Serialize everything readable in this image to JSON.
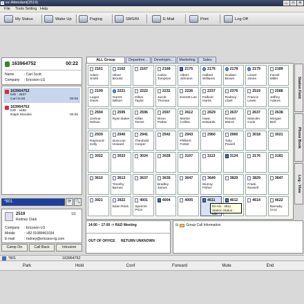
{
  "window": {
    "title": "ez-Attendant(2519)",
    "min": "_",
    "max": "□",
    "close": "✕"
  },
  "menu": [
    "File",
    "Tools Setting",
    "Help"
  ],
  "toolbar": [
    {
      "label": "My Status",
      "icon": "status-icon"
    },
    {
      "label": "Wake Up",
      "icon": "alarm-icon"
    },
    {
      "label": "Paging",
      "icon": "paging-icon"
    },
    {
      "label": "SMS/M",
      "icon": "sms-icon"
    },
    {
      "label": "E-Mail",
      "icon": "email-icon"
    },
    {
      "label": "Print",
      "icon": "print-icon"
    },
    {
      "label": "Log Off",
      "icon": "logoff-icon"
    }
  ],
  "current_call": {
    "number": "163964752",
    "timer": "00:22",
    "name_label": "Name",
    "name_value": ": Carl Scott",
    "company_label": "Company",
    "company_value": ": Ericsson-LG"
  },
  "wait_list": [
    {
      "number": "163964752",
      "line1": "DID : 4837",
      "line2": "Carl Scott",
      "time": "00:06"
    },
    {
      "number": "163964752",
      "line1": "DID : 4488",
      "line2": "Ralph Morales",
      "time": "00:06"
    }
  ],
  "search": {
    "value": "*801",
    "go": "⟳",
    "find": "🔍"
  },
  "dir_info": {
    "ext": "2519",
    "name": "Rodney Clark",
    "page": "1/1",
    "company_label": "Company",
    "company_value": ": Ericsson-LG",
    "mobile_label": "Mobile",
    "mobile_value": ": +82 01089461034",
    "email_label": "E-mail",
    "email_value": ": rodney@ericsson-lg.com"
  },
  "action_buttons": [
    "Camp On",
    "Call Back",
    "Intrusion"
  ],
  "tabs": [
    "ALL Group",
    "Departme...",
    "Developm...",
    "Marketing",
    "Sales"
  ],
  "grid": [
    [
      "2161",
      "Adam Smith"
    ],
    [
      "2162",
      "Oliver\nBrooks"
    ],
    [
      "2167",
      ""
    ],
    [
      "2168",
      "Calvin\nTompson"
    ],
    [
      "2175",
      "Albert\nJohnson"
    ],
    [
      "2176",
      "Halbert\nWilliams"
    ],
    [
      "2178",
      "Godwin\nBrown"
    ],
    [
      "2179",
      "Lionel\nJones"
    ],
    [
      "2189",
      "Farrell\nMiller"
    ],
    [
      "2199",
      "Logan\nDavis"
    ],
    [
      "2221",
      "Garret\nWilson"
    ],
    [
      "2222",
      "Dillon\nTaylor"
    ],
    [
      "2232",
      "Jacob\nThomas"
    ],
    [
      "2236",
      "Everett Lee"
    ],
    [
      "2237",
      "Falkner\nHarris"
    ],
    [
      "2376",
      "Rodney\nClark"
    ],
    [
      "2519",
      "Francis\nLewis"
    ],
    [
      "2588",
      "Jeffrey\nAdams"
    ],
    [
      "2594",
      "Joshua\nNelson"
    ],
    [
      "2595",
      "Ryan Baker"
    ],
    [
      "2596",
      "Killan\nTorres"
    ],
    [
      "2597",
      "Dixon\nParker"
    ],
    [
      "2612",
      "Marlon\nCollins"
    ],
    [
      "2629",
      "Isaac\nEdwards"
    ],
    [
      "2637",
      "Ronald\nMorris"
    ],
    [
      "2637",
      "Malcolm\nCook"
    ],
    [
      "2638",
      "Morgan\nBell"
    ],
    [
      "2939",
      "Raymond\nKelly"
    ],
    [
      "2940",
      "Dunccan\nHoward"
    ],
    [
      "2941",
      "Theobold\nCooper"
    ],
    [
      "2942",
      "",
      ""
    ],
    [
      "2943",
      "Philbert\nFoster"
    ],
    [
      "2960",
      ""
    ],
    [
      "2960",
      "Toby\nPowell"
    ],
    [
      "3018",
      ""
    ],
    [
      "3021",
      ""
    ],
    [
      "3022",
      ""
    ],
    [
      "3023",
      ""
    ],
    [
      "3024",
      ""
    ],
    [
      "3028",
      ""
    ],
    [
      "3107",
      ""
    ],
    [
      "3113",
      ""
    ],
    [
      "3124",
      ""
    ],
    [
      "3176",
      ""
    ],
    [
      "3181",
      ""
    ],
    [
      "3610",
      ""
    ],
    [
      "3613",
      "Timothy\nBarnes"
    ],
    [
      "3637",
      ""
    ],
    [
      "3639",
      "Bradley\nJames"
    ],
    [
      "3647",
      ""
    ],
    [
      "3649",
      "Murray\nFisher"
    ],
    [
      "3829",
      ""
    ],
    [
      "3829",
      "Frank\nRussell"
    ],
    [
      "3847",
      ""
    ],
    [
      "3921",
      ""
    ],
    [
      "3922",
      "Edan Ross"
    ],
    [
      "4001",
      "Spencer\nPrice"
    ],
    [
      "4004",
      ""
    ],
    [
      "4005",
      ""
    ],
    [
      "4611",
      ""
    ],
    [
      "4612",
      ""
    ],
    [
      "4614",
      ""
    ],
    [
      "4622",
      "Barnaby\nCruz"
    ]
  ],
  "grid_states": [
    "p",
    "p",
    "p",
    "p",
    "b",
    "sp",
    "sp",
    "sp",
    "p",
    "p",
    "sp",
    "p",
    "p",
    "p",
    "p",
    "p",
    "p",
    "p",
    "p",
    "p",
    "p",
    "p",
    "p",
    "p",
    "p",
    "p",
    "p",
    "p",
    "p",
    "p",
    "p",
    "p",
    "p",
    "p",
    "p",
    "p",
    "p",
    "p",
    "p",
    "p",
    "p",
    "p",
    "b",
    "p",
    "p",
    "p",
    "p",
    "p",
    "p",
    "p",
    "p",
    "p",
    "p",
    "p",
    "p",
    "p",
    "p",
    "b",
    "p",
    "b",
    "b",
    "p",
    "p"
  ],
  "tooltip": {
    "line1": "Dn No   : 4611",
    "line2": "Station Status : Idle"
  },
  "side_tabs": [
    "Station Field",
    "Phone Book",
    "Log - View"
  ],
  "memo": {
    "schedule": "14:00 ~ 17:00 -> R&D Meeting",
    "status1": "OUT OF OFFICE",
    "status2": "RETURN UNKNOWN"
  },
  "group_info": "Group Call Information",
  "bottom_call": {
    "ext": "*801",
    "number": "163964752"
  },
  "functions": [
    "Park",
    "Hold",
    "Conf",
    "Forward",
    "Mute",
    "End"
  ]
}
